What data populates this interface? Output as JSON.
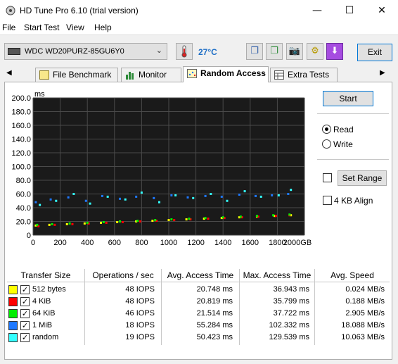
{
  "window": {
    "title": "HD Tune Pro 6.10 (trial version)"
  },
  "menu": [
    "File",
    "Start Test",
    "View",
    "Help"
  ],
  "toolbar": {
    "drive": "WDC WD20PURZ-85GU6Y0",
    "temperature": "27°C",
    "exit_label": "Exit"
  },
  "tabs": [
    "File Benchmark",
    "Monitor",
    "Random Access",
    "Extra Tests"
  ],
  "active_tab": "Random Access",
  "side": {
    "start_label": "Start",
    "read_label": "Read",
    "write_label": "Write",
    "mode": "read",
    "set_range_label": "Set Range",
    "align_label": "4 KB Align"
  },
  "colors": {
    "512 bytes": "#ffff00",
    "4 KiB": "#ff0000",
    "64 KiB": "#00ee00",
    "1 MiB": "#1e78ff",
    "random": "#33ffff"
  },
  "chart_data": {
    "type": "scatter",
    "xlabel": "",
    "ylabel": "ms",
    "x_unit": "GB",
    "xlim": [
      0,
      2000
    ],
    "ylim": [
      0,
      200
    ],
    "x_ticks": [
      "0",
      "200",
      "400",
      "600",
      "800",
      "1000",
      "1200",
      "1400",
      "1600",
      "1800",
      "2000GB"
    ],
    "y_ticks": [
      "0",
      "20.0",
      "40.0",
      "60.0",
      "80.0",
      "100.0",
      "120.0",
      "140.0",
      "160.0",
      "180.0",
      "200.0"
    ],
    "grid": true,
    "series": [
      {
        "name": "512 bytes",
        "color": "#ffff00",
        "x": [
          20,
          120,
          250,
          380,
          500,
          620,
          760,
          880,
          1000,
          1130,
          1260,
          1390,
          1520,
          1650,
          1780,
          1900
        ],
        "y": [
          14,
          15,
          16,
          17,
          18,
          19,
          20,
          21,
          22,
          23,
          24,
          25,
          26,
          27,
          28,
          29
        ]
      },
      {
        "name": "4 KiB",
        "color": "#ff0000",
        "x": [
          40,
          160,
          290,
          410,
          540,
          660,
          790,
          910,
          1040,
          1160,
          1290,
          1410,
          1540,
          1660,
          1790,
          1890
        ],
        "y": [
          13,
          15,
          16,
          17,
          18,
          19,
          20,
          21,
          22,
          23,
          24,
          25,
          26,
          27,
          28,
          29
        ]
      },
      {
        "name": "64 KiB",
        "color": "#00ee00",
        "x": [
          30,
          140,
          270,
          400,
          520,
          640,
          770,
          900,
          1020,
          1150,
          1270,
          1400,
          1530,
          1650,
          1770,
          1890
        ],
        "y": [
          15,
          16,
          17,
          18,
          19,
          20,
          21,
          22,
          23,
          24,
          25,
          26,
          27,
          28,
          29,
          30
        ]
      },
      {
        "name": "1 MiB",
        "color": "#1e78ff",
        "x": [
          20,
          130,
          260,
          390,
          510,
          640,
          760,
          890,
          1020,
          1140,
          1270,
          1390,
          1520,
          1640,
          1760,
          1880
        ],
        "y": [
          48,
          52,
          55,
          50,
          57,
          53,
          56,
          54,
          58,
          55,
          57,
          56,
          59,
          57,
          58,
          60
        ]
      },
      {
        "name": "random",
        "color": "#33ffff",
        "x": [
          50,
          170,
          300,
          420,
          550,
          680,
          800,
          930,
          1050,
          1180,
          1310,
          1430,
          1560,
          1680,
          1810,
          1900
        ],
        "y": [
          44,
          50,
          60,
          46,
          56,
          52,
          62,
          48,
          58,
          54,
          60,
          50,
          64,
          56,
          58,
          66
        ]
      }
    ]
  },
  "table": {
    "headers": [
      "Transfer Size",
      "Operations / sec",
      "Avg. Access Time",
      "Max. Access Time",
      "Avg. Speed"
    ],
    "rows": [
      {
        "size": "512 bytes",
        "color": "#ffff00",
        "ops": "48 IOPS",
        "avg": "20.748 ms",
        "max": "36.943 ms",
        "speed": "0.024 MB/s"
      },
      {
        "size": "4 KiB",
        "color": "#ff0000",
        "ops": "48 IOPS",
        "avg": "20.819 ms",
        "max": "35.799 ms",
        "speed": "0.188 MB/s"
      },
      {
        "size": "64 KiB",
        "color": "#00ee00",
        "ops": "46 IOPS",
        "avg": "21.514 ms",
        "max": "37.722 ms",
        "speed": "2.905 MB/s"
      },
      {
        "size": "1 MiB",
        "color": "#1e78ff",
        "ops": "18 IOPS",
        "avg": "55.284 ms",
        "max": "102.332 ms",
        "speed": "18.088 MB/s"
      },
      {
        "size": "random",
        "color": "#33ffff",
        "ops": "19 IOPS",
        "avg": "50.423 ms",
        "max": "129.539 ms",
        "speed": "10.063 MB/s"
      }
    ]
  }
}
